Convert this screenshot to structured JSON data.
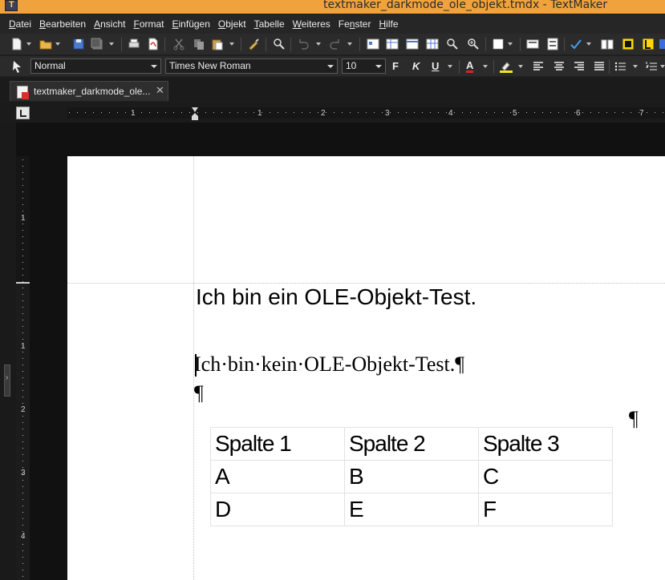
{
  "window": {
    "title": "textmaker_darkmode_ole_objekt.tmdx - TextMaker"
  },
  "menu": [
    {
      "label": "Datei",
      "accel": "D",
      "rest": "atei"
    },
    {
      "label": "Bearbeiten",
      "accel": "B",
      "rest": "earbeiten"
    },
    {
      "label": "Ansicht",
      "accel": "A",
      "rest": "nsicht"
    },
    {
      "label": "Format",
      "accel": "F",
      "rest": "ormat"
    },
    {
      "label": "Einfügen",
      "accel": "E",
      "rest": "infügen"
    },
    {
      "label": "Objekt",
      "accel": "O",
      "rest": "bjekt"
    },
    {
      "label": "Tabelle",
      "accel": "T",
      "rest": "abelle"
    },
    {
      "label": "Weiteres",
      "accel": "W",
      "rest": "eiteres"
    },
    {
      "label": "Fenster",
      "accel": "n",
      "pre": "Fe",
      "rest": "ster"
    },
    {
      "label": "Hilfe",
      "accel": "H",
      "rest": "ilfe"
    }
  ],
  "format_bar": {
    "style": "Normal",
    "font": "Times New Roman",
    "size": "10",
    "bold": "F",
    "italic": "K",
    "underline": "U",
    "font_color": "A"
  },
  "tab": {
    "label": "textmaker_darkmode_ole...",
    "close": "✕"
  },
  "ruler": {
    "h_numbers": [
      "1",
      "1",
      "2",
      "3",
      "4",
      "5",
      "6",
      "7"
    ],
    "v_numbers": [
      "1",
      "1",
      "2",
      "3",
      "4"
    ]
  },
  "document": {
    "ole_text": "Ich bin ein OLE-Objekt-Test.",
    "body_text": "Ich·bin·kein·OLE-Objekt-Test.¶",
    "pilcrow": "¶",
    "table": {
      "headers": [
        "Spalte 1",
        "Spalte 2",
        "Spalte 3"
      ],
      "rows": [
        [
          "A",
          "B",
          "C"
        ],
        [
          "D",
          "E",
          "F"
        ]
      ]
    }
  },
  "colors": {
    "titlebar": "#f0a33c",
    "chrome": "#2b2b2b",
    "workspace": "#111111",
    "page": "#ffffff",
    "font_color_underline": "#e02020",
    "highlight_underline": "#f2e51a"
  }
}
